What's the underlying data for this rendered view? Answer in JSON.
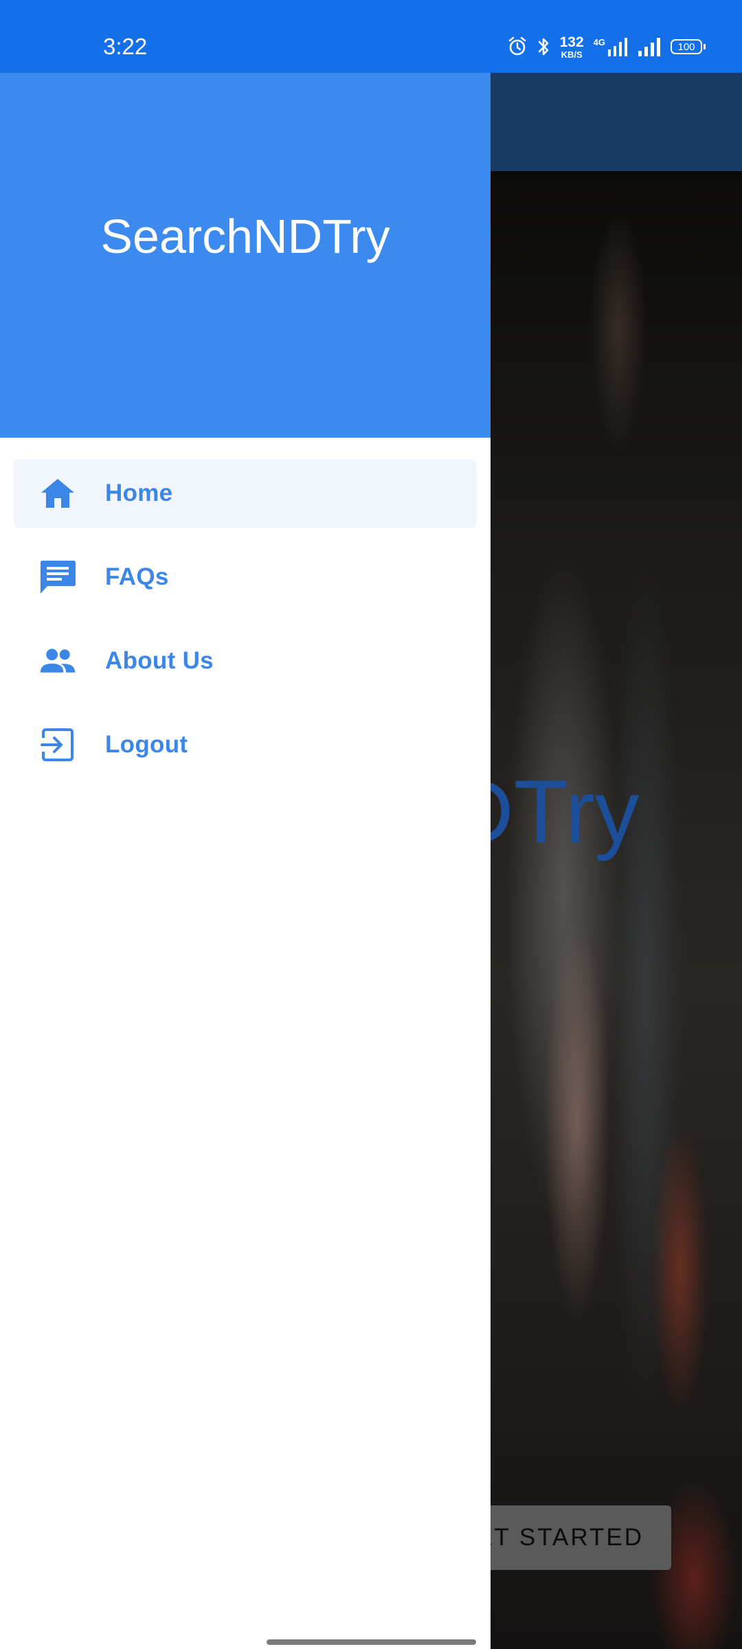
{
  "status_bar": {
    "time": "3:22",
    "net_speed_value": "132",
    "net_speed_unit": "KB/S",
    "network_type": "4G",
    "battery": "100",
    "icons": [
      "alarm-icon",
      "bluetooth-icon",
      "signal-icon",
      "signal-icon",
      "battery-icon"
    ]
  },
  "drawer": {
    "title": "SearchNDTry",
    "items": [
      {
        "label": "Home",
        "icon": "home-icon",
        "active": true
      },
      {
        "label": "FAQs",
        "icon": "chat-icon",
        "active": false
      },
      {
        "label": "About Us",
        "icon": "people-icon",
        "active": false
      },
      {
        "label": "Logout",
        "icon": "logout-icon",
        "active": false
      }
    ]
  },
  "background_app": {
    "hero_line1": "O",
    "hero_line2": "NDTry",
    "cta_label": "ET STARTED"
  },
  "colors": {
    "status_bar": "#1470E8",
    "drawer_header": "#3D8AEE",
    "accent": "#3B86E6",
    "active_item_bg": "#F1F6FC"
  }
}
